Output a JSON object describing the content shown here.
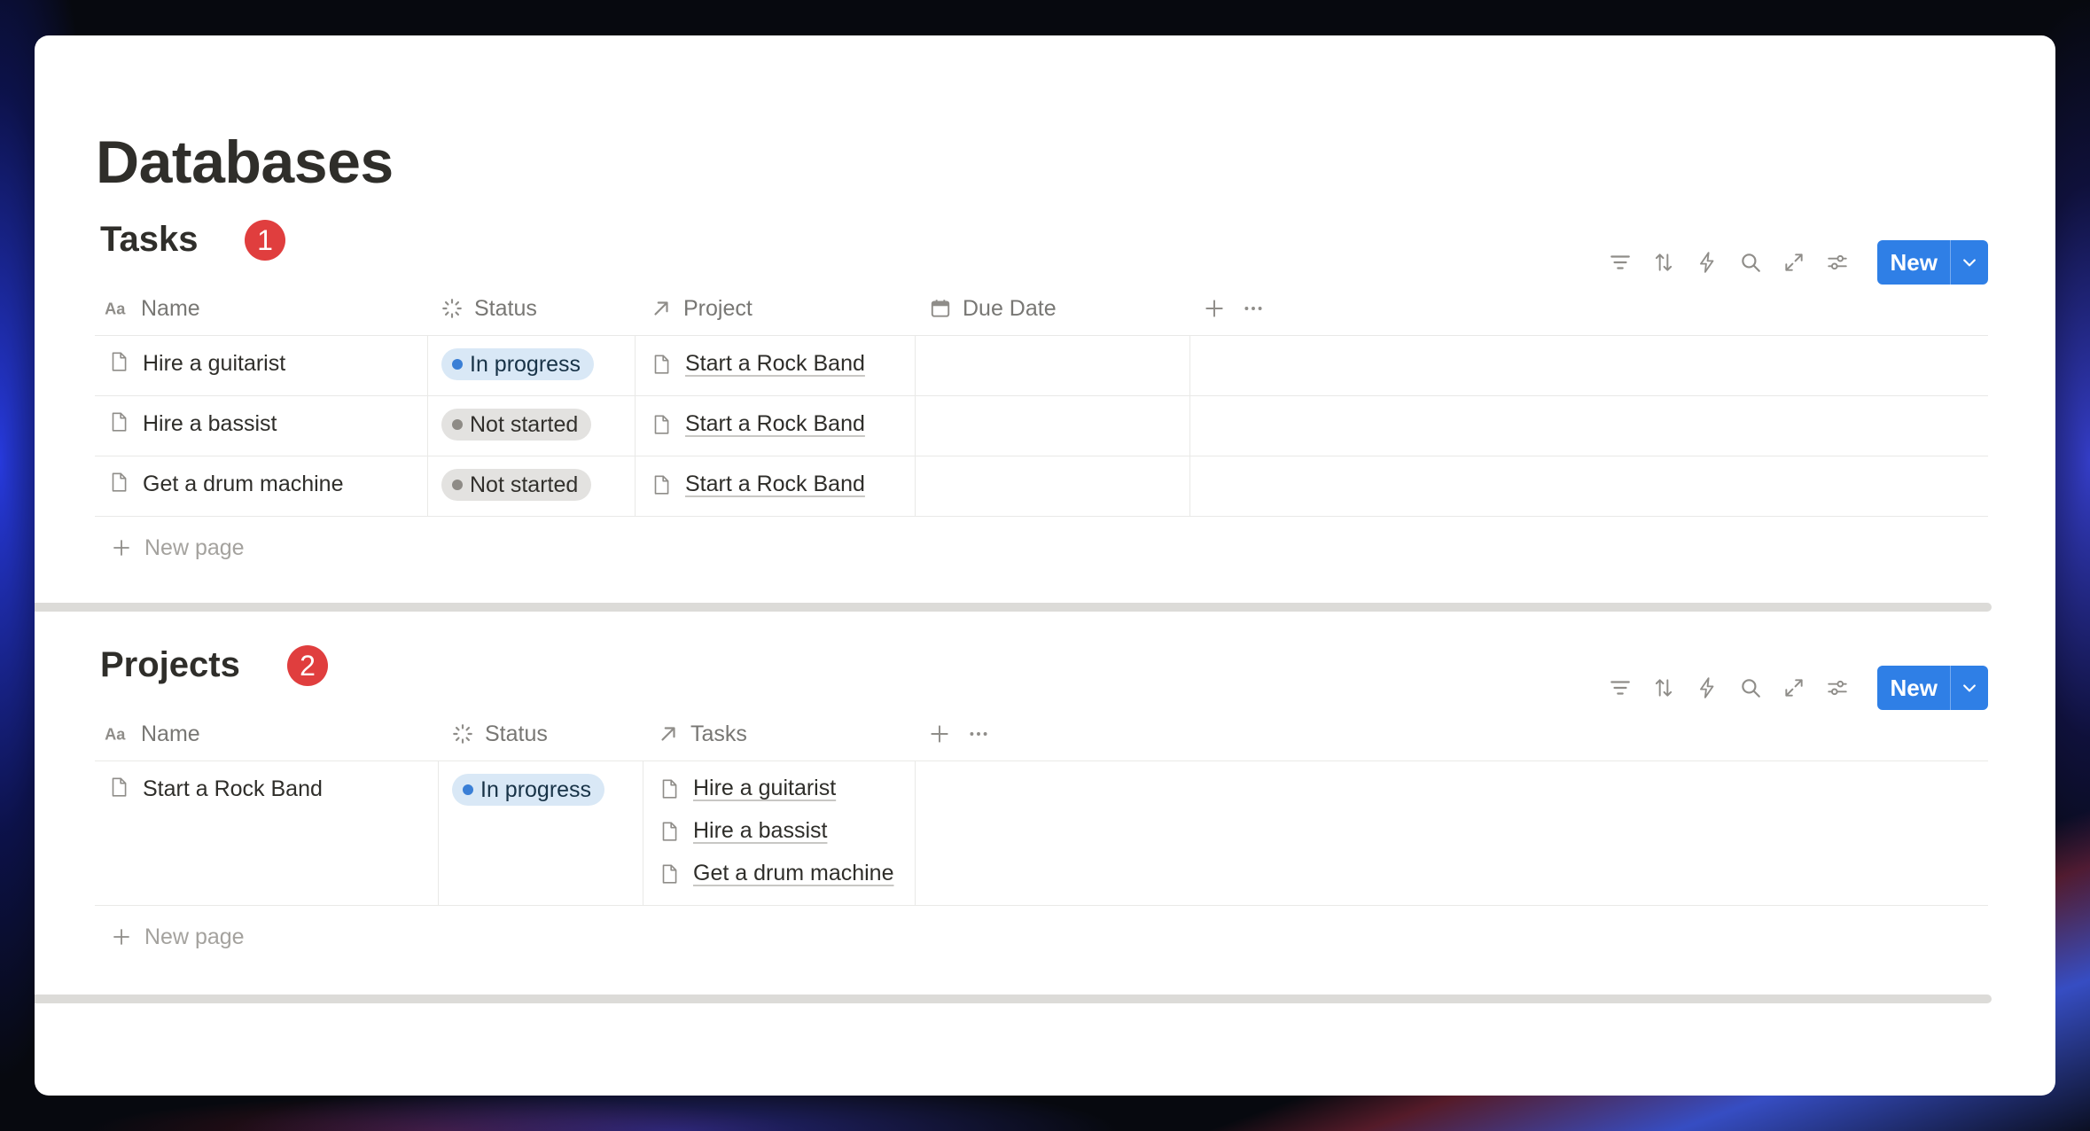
{
  "page": {
    "title": "Databases"
  },
  "tasks_db": {
    "title": "Tasks",
    "badge": "1",
    "new_label": "New",
    "columns": {
      "name": "Name",
      "status": "Status",
      "project": "Project",
      "due_date": "Due Date"
    },
    "rows": [
      {
        "name": "Hire a guitarist",
        "status": "In progress",
        "project": "Start a Rock Band",
        "due_date": ""
      },
      {
        "name": "Hire a bassist",
        "status": "Not started",
        "project": "Start a Rock Band",
        "due_date": ""
      },
      {
        "name": "Get a drum machine",
        "status": "Not started",
        "project": "Start a Rock Band",
        "due_date": ""
      }
    ],
    "new_page_label": "New page"
  },
  "projects_db": {
    "title": "Projects",
    "badge": "2",
    "new_label": "New",
    "columns": {
      "name": "Name",
      "status": "Status",
      "tasks": "Tasks"
    },
    "rows": [
      {
        "name": "Start a Rock Band",
        "status": "In progress",
        "tasks": [
          "Hire a guitarist",
          "Hire a bassist",
          "Get a drum machine"
        ]
      }
    ],
    "new_page_label": "New page"
  },
  "status_colors": {
    "in_progress": "#3a7fd6",
    "not_started": "#8e8b86"
  },
  "colors": {
    "accent": "#2f7fe6",
    "badge": "#e03e3e"
  },
  "toolbar_icons": [
    "filter-icon",
    "sort-icon",
    "automation-icon",
    "search-icon",
    "expand-icon",
    "settings-icon"
  ]
}
